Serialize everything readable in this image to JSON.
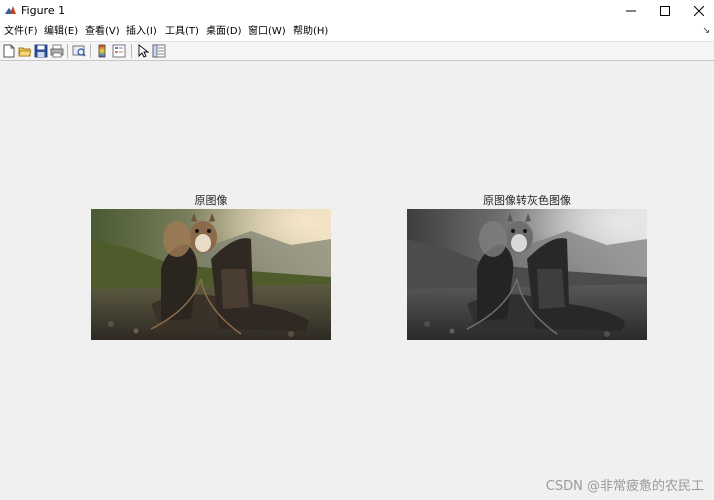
{
  "window": {
    "title": "Figure 1"
  },
  "menu": {
    "items": [
      {
        "label": "文件(F)"
      },
      {
        "label": "编辑(E)"
      },
      {
        "label": "查看(V)"
      },
      {
        "label": "插入(I)"
      },
      {
        "label": "工具(T)"
      },
      {
        "label": "桌面(D)"
      },
      {
        "label": "窗口(W)"
      },
      {
        "label": "帮助(H)"
      }
    ]
  },
  "toolbar": {
    "icons": [
      "new-figure-icon",
      "open-file-icon",
      "save-icon",
      "print-icon",
      "link-plot-icon",
      "colorbar-icon",
      "legend-icon",
      "pointer-icon",
      "property-inspector-icon"
    ]
  },
  "axes": [
    {
      "title": "原图像",
      "image": "squirrel-on-boots-color"
    },
    {
      "title": "原图像转灰色图像",
      "image": "squirrel-on-boots-grayscale"
    }
  ],
  "watermark": "CSDN @非常疲惫的农民工"
}
